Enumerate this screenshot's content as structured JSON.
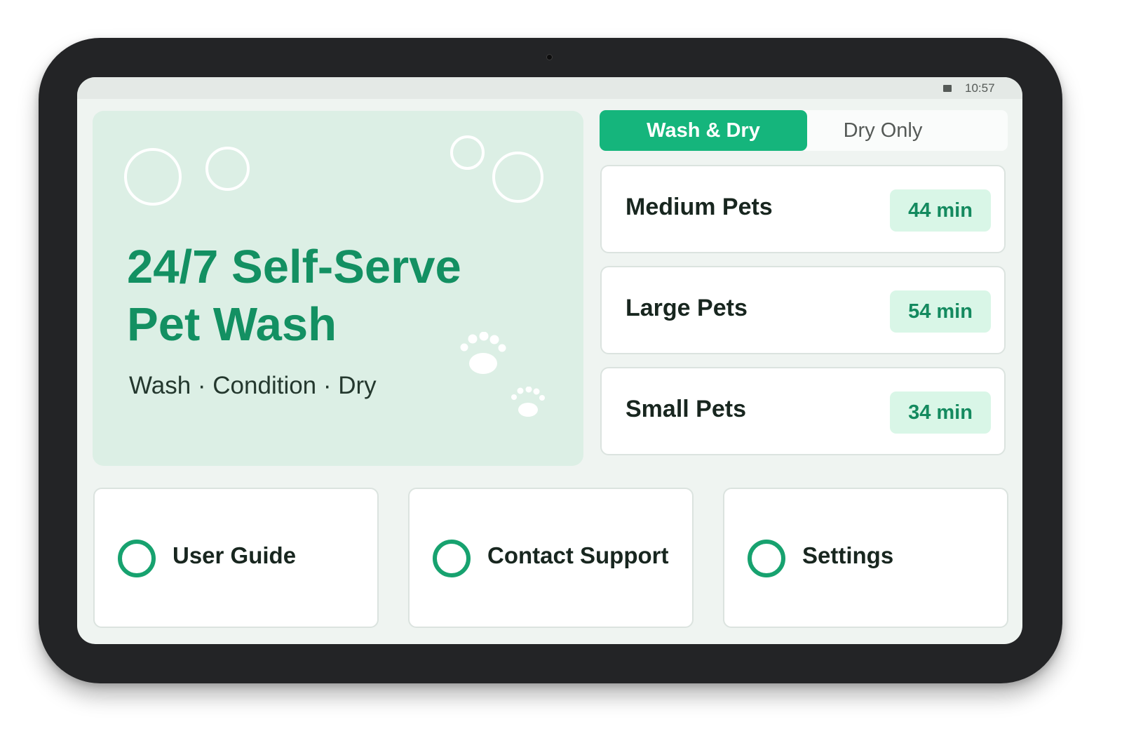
{
  "status_bar": {
    "time": "10:57",
    "battery_icon": "battery-icon"
  },
  "hero": {
    "title_line1": "24/7 Self-Serve",
    "title_line2": "Pet Wash",
    "subtitle": "Wash · Condition · Dry",
    "decorations": [
      "bubble-icon",
      "paw-print-icon"
    ]
  },
  "tabs": [
    {
      "label": "Wash & Dry",
      "active": true
    },
    {
      "label": "Dry Only",
      "active": false
    }
  ],
  "pet_sizes": [
    {
      "label": "Medium Pets",
      "duration": "44 min"
    },
    {
      "label": "Large Pets",
      "duration": "54 min"
    },
    {
      "label": "Small Pets",
      "duration": "34 min"
    }
  ],
  "actions": [
    {
      "label": "User Guide",
      "icon": "ring-icon"
    },
    {
      "label": "Contact Support",
      "icon": "ring-icon"
    },
    {
      "label": "Settings",
      "icon": "ring-icon"
    }
  ],
  "colors": {
    "accent": "#15b57c",
    "accent_text": "#139062",
    "hero_bg": "#dcefe5",
    "badge_bg": "#d9f6e7",
    "screen_bg": "#eff4f1",
    "bezel": "#232426"
  }
}
